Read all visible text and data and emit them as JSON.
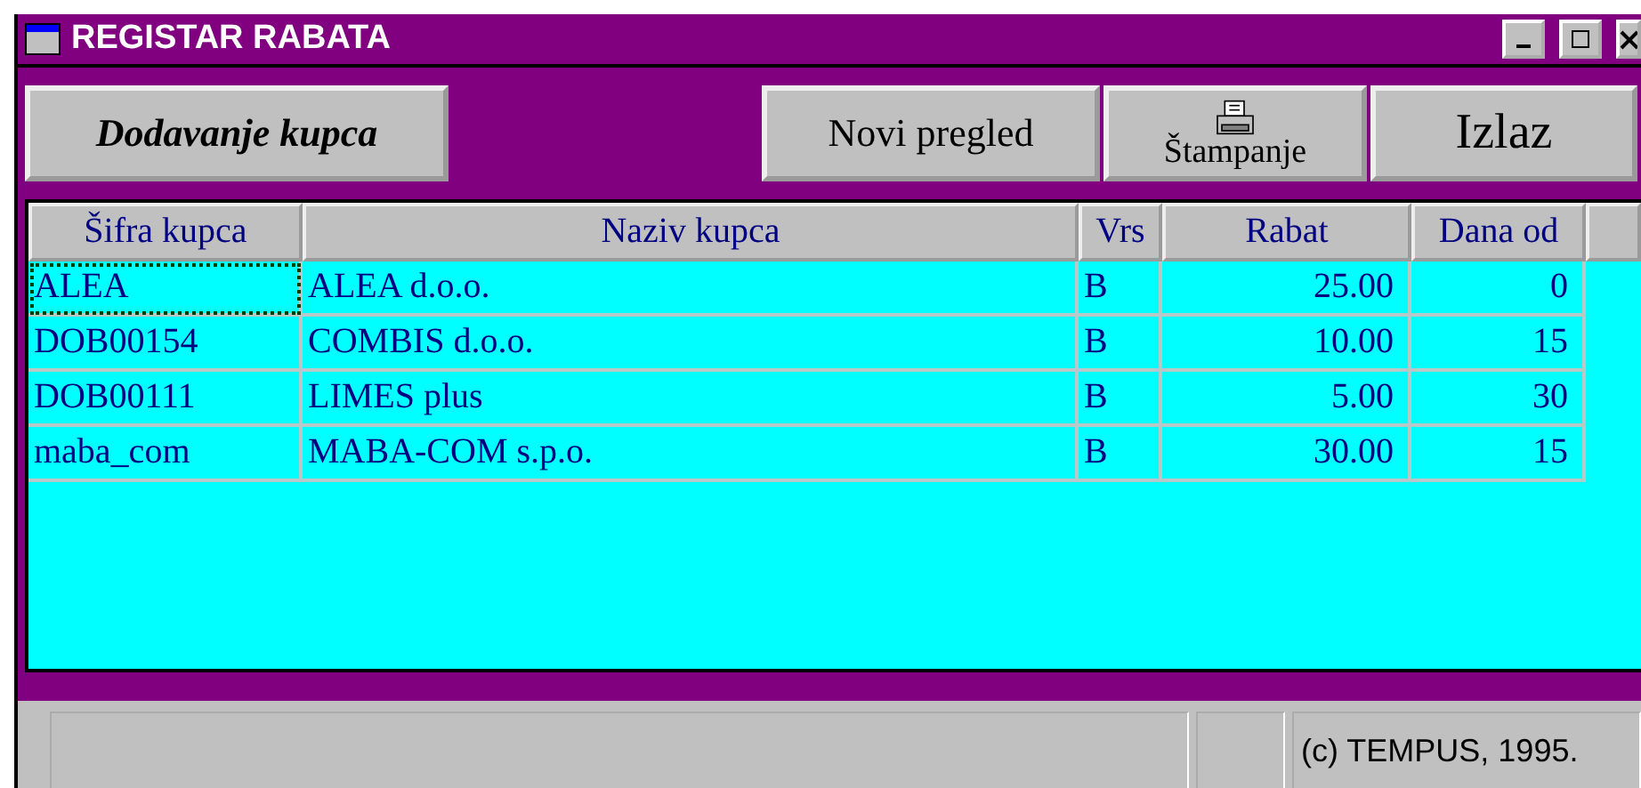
{
  "window": {
    "title": "REGISTAR RABATA"
  },
  "toolbar": {
    "add_button": "Dodavanje kupca",
    "buttons": [
      {
        "label": "Novi pregled",
        "kind": "text"
      },
      {
        "label": "Štampanje",
        "kind": "print"
      },
      {
        "label": "Izlaz",
        "kind": "large"
      }
    ]
  },
  "table": {
    "columns": [
      "Šifra kupca",
      "Naziv kupca",
      "Vrs",
      "Rabat",
      "Dana od"
    ],
    "rows": [
      {
        "cells": [
          "ALEA",
          "ALEA d.o.o.",
          "B",
          "25.00",
          "0"
        ],
        "selected": true
      },
      {
        "cells": [
          "DOB00154",
          "COMBIS d.o.o.",
          "B",
          "10.00",
          "15"
        ],
        "selected": false
      },
      {
        "cells": [
          "DOB00111",
          "LIMES plus",
          "B",
          "5.00",
          "30"
        ],
        "selected": false
      },
      {
        "cells": [
          "maba_com",
          "MABA-COM s.p.o.",
          "B",
          "30.00",
          "15"
        ],
        "selected": false
      }
    ]
  },
  "status_bar": {
    "copyright": "(c) TEMPUS, 1995."
  }
}
